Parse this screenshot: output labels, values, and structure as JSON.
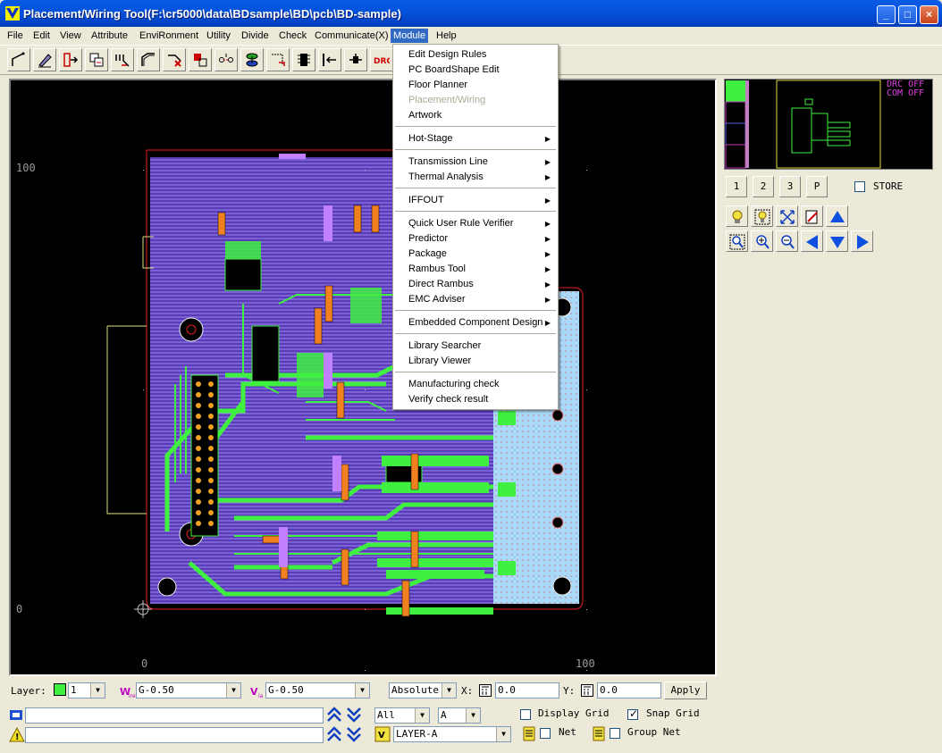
{
  "window": {
    "title": "Placement/Wiring Tool(F:\\cr5000\\data\\BDsample\\BD\\pcb\\BD-sample)",
    "minimize": "_",
    "maximize": "□",
    "close": "×"
  },
  "menubar": [
    "File",
    "Edit",
    "View",
    "Attribute",
    "EnviRonment",
    "Utility",
    "Divide",
    "Check",
    "Communicate(X)",
    "Module",
    "Help"
  ],
  "active_menu": "Module",
  "module_menu": [
    {
      "label": "Edit Design Rules"
    },
    {
      "label": "PC BoardShape Edit"
    },
    {
      "label": "Floor Planner"
    },
    {
      "label": "Placement/Wiring",
      "disabled": true
    },
    {
      "label": "Artwork"
    },
    {
      "label": "Hot-Stage",
      "submenu": true
    },
    {
      "label": "Transmission Line",
      "submenu": true
    },
    {
      "label": "Thermal Analysis",
      "submenu": true
    },
    {
      "label": "IFFOUT",
      "submenu": true
    },
    {
      "label": "Quick User Rule Verifier",
      "submenu": true
    },
    {
      "label": "Predictor",
      "submenu": true
    },
    {
      "label": "Package",
      "submenu": true
    },
    {
      "label": "Rambus Tool",
      "submenu": true
    },
    {
      "label": "Direct Rambus",
      "submenu": true
    },
    {
      "label": "EMC Adviser",
      "submenu": true
    },
    {
      "label": "Embedded Component Design",
      "submenu": true
    },
    {
      "label": "Library Searcher"
    },
    {
      "label": "Library Viewer"
    },
    {
      "label": "Manufacturing check"
    },
    {
      "label": "Verify check result"
    }
  ],
  "toolbar": {
    "icons": [
      "line-icon",
      "edit-pen-icon",
      "move-icon",
      "copy-icon",
      "route-icon",
      "wire-icon",
      "delete-wire-icon",
      "rotate-icon",
      "connect-icon",
      "via-icon",
      "unroute-icon",
      "grid-icon",
      "align-icon",
      "place-icon"
    ],
    "drc_label": "DRC"
  },
  "canvas": {
    "y_labels": [
      "100",
      "0"
    ],
    "x_labels": [
      "0",
      "100"
    ]
  },
  "minimap": {
    "drc_status": "DRC OFF",
    "com_status": "COM OFF"
  },
  "page_buttons": [
    "1",
    "2",
    "3",
    "P"
  ],
  "store_label": "STORE",
  "view_buttons": [
    "bulb-icon",
    "bulb-select-icon",
    "fit-icon",
    "redraw-icon",
    "arrow-up-icon",
    "zoom-window-icon",
    "zoom-in-icon",
    "zoom-out-icon",
    "arrow-left-icon",
    "arrow-down-icon",
    "arrow-right-icon"
  ],
  "statusbar": {
    "layer_label": "Layer:",
    "layer_value": "1",
    "wire_value": "G-0.50",
    "via_value": "G-0.50",
    "coord_mode": "Absolute",
    "x_label": "X:",
    "x_value": "0.0",
    "y_label": "Y:",
    "y_value": "0.0",
    "apply_label": "Apply",
    "filter_all": "All",
    "filter_a": "A",
    "display_grid": "Display Grid",
    "snap_grid": "Snap Grid",
    "layer_name": "LAYER-A",
    "net_label": "Net",
    "group_net_label": "Group Net",
    "message_value": "",
    "prompt_value": ""
  },
  "colors": {
    "board_purple": "#7B54D8",
    "copper_green": "#40F040",
    "pad_orange": "#F08020",
    "board_light_blue": "#A9D8F8",
    "outline_red": "#E02020",
    "silk_yellow": "#E0E080",
    "selection_blue": "#316AC5"
  }
}
